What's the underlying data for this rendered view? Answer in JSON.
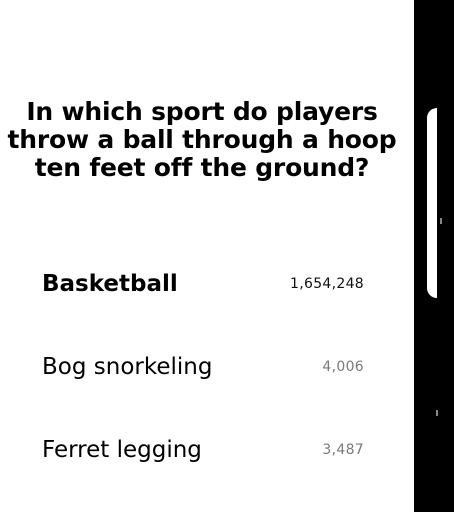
{
  "question": {
    "text": "In which sport do players throw a ball through a hoop ten feet off the ground?"
  },
  "answers": [
    {
      "label": "Basketball",
      "count": "1,654,248",
      "selected": true
    },
    {
      "label": "Bog snorkeling",
      "count": "4,006",
      "selected": false
    },
    {
      "label": "Ferret legging",
      "count": "3,487",
      "selected": false
    }
  ],
  "colors": {
    "background": "#ffffff",
    "text": "#000000",
    "side_panel": "#000000",
    "muted_count": "#7a7a7a"
  }
}
